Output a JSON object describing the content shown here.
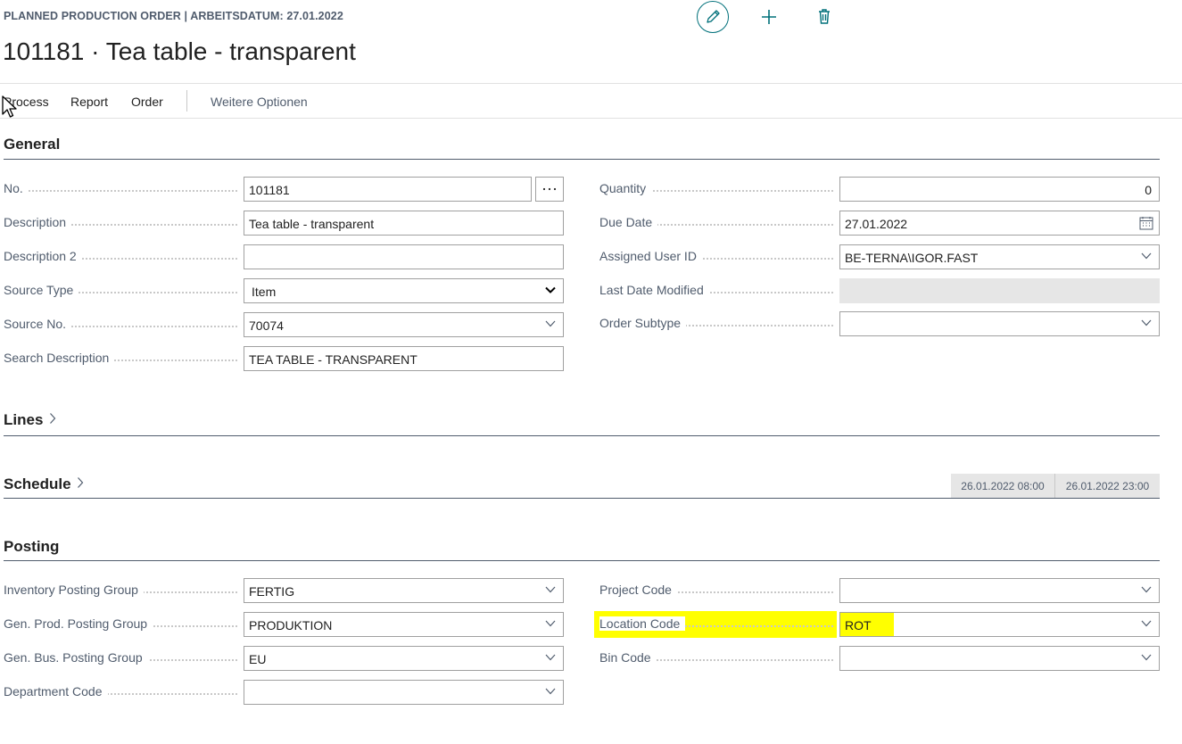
{
  "header": {
    "caption": "PLANNED PRODUCTION ORDER | ARBEITSDATUM: 27.01.2022",
    "title": "101181 · Tea table - transparent"
  },
  "actions": {
    "menu": [
      "Process",
      "Report",
      "Order",
      "Weitere Optionen"
    ]
  },
  "sections": {
    "general": "General",
    "lines": "Lines",
    "schedule": "Schedule",
    "posting": "Posting"
  },
  "general_left": [
    {
      "label": "No.",
      "value": "101181"
    },
    {
      "label": "Description",
      "value": "Tea table - transparent"
    },
    {
      "label": "Description 2",
      "value": ""
    },
    {
      "label": "Source Type",
      "value": "Item"
    },
    {
      "label": "Source No.",
      "value": "70074"
    },
    {
      "label": "Search Description",
      "value": "TEA TABLE - TRANSPARENT"
    }
  ],
  "general_right": [
    {
      "label": "Quantity",
      "value": "0"
    },
    {
      "label": "Due Date",
      "value": "27.01.2022"
    },
    {
      "label": "Assigned User ID",
      "value": "BE-TERNA\\IGOR.FAST"
    },
    {
      "label": "Last Date Modified",
      "value": ""
    },
    {
      "label": "Order Subtype",
      "value": ""
    }
  ],
  "schedule": {
    "start": "26.01.2022 08:00",
    "end": "26.01.2022 23:00"
  },
  "posting_left": [
    {
      "label": "Inventory Posting Group",
      "value": "FERTIG"
    },
    {
      "label": "Gen. Prod. Posting Group",
      "value": "PRODUKTION"
    },
    {
      "label": "Gen. Bus. Posting Group",
      "value": "EU"
    },
    {
      "label": "Department Code",
      "value": ""
    }
  ],
  "posting_right": [
    {
      "label": "Project Code",
      "value": ""
    },
    {
      "label": "Location Code",
      "value": "ROT"
    },
    {
      "label": "Bin Code",
      "value": ""
    }
  ],
  "icons": {
    "edit": "pencil-icon",
    "new": "plus-icon",
    "delete": "trash-icon",
    "lookup": "ellipsis-icon",
    "calendar": "calendar-icon",
    "dropdown": "chevron-down-icon",
    "expand": "chevron-right-icon"
  },
  "colors": {
    "accent": "#00707a",
    "highlight": "#ffff00"
  }
}
